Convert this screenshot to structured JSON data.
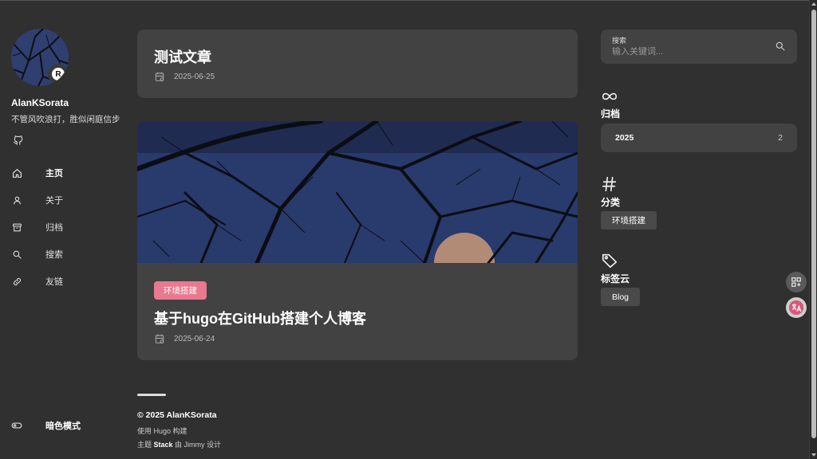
{
  "sidebar": {
    "site_name": "AlanKSorata",
    "site_desc": "不管风吹浪打，胜似闲庭信步",
    "avatar_badge": "R",
    "menu": [
      {
        "label": "主页",
        "icon": "home-icon",
        "active": true
      },
      {
        "label": "关于",
        "icon": "user-icon",
        "active": false
      },
      {
        "label": "归档",
        "icon": "archive-icon",
        "active": false
      },
      {
        "label": "搜索",
        "icon": "search-icon",
        "active": false
      },
      {
        "label": "友链",
        "icon": "link-icon",
        "active": false
      }
    ],
    "dark_mode_label": "暗色模式"
  },
  "posts": [
    {
      "title": "测试文章",
      "date": "2025-06-25"
    },
    {
      "title": "基于hugo在GitHub搭建个人博客",
      "date": "2025-06-24",
      "category": "环境搭建"
    }
  ],
  "footer": {
    "copyright": "© 2025 AlanKSorata",
    "built_prefix": "使用 Hugo 构建",
    "theme_prefix": "主题 ",
    "theme_name": "Stack",
    "theme_suffix": " 由 Jimmy 设计"
  },
  "search": {
    "label": "搜索",
    "placeholder": "输入关键词..."
  },
  "widgets": {
    "archive_title": "归档",
    "archive_rows": [
      {
        "year": "2025",
        "count": "2"
      }
    ],
    "category_title": "分类",
    "categories": [
      "环境搭建"
    ],
    "tagcloud_title": "标签云",
    "tags": [
      "Blog"
    ]
  },
  "colors": {
    "background": "#303030",
    "card": "#424242",
    "accent_tag": "#e8798f"
  }
}
